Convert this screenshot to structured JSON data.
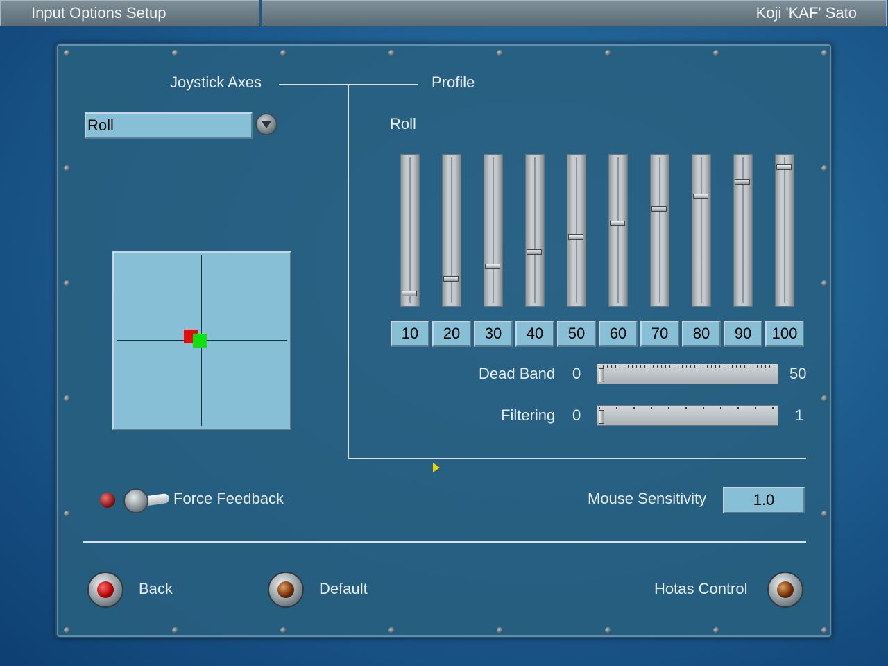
{
  "header": {
    "title": "Input Options Setup",
    "user": "Koji 'KAF' Sato"
  },
  "axes": {
    "heading": "Joystick Axes",
    "selected": "Roll"
  },
  "profile": {
    "heading": "Profile",
    "axis_label": "Roll",
    "points": [
      {
        "label": "10",
        "level": 0.05
      },
      {
        "label": "20",
        "level": 0.15
      },
      {
        "label": "30",
        "level": 0.24
      },
      {
        "label": "40",
        "level": 0.34
      },
      {
        "label": "50",
        "level": 0.44
      },
      {
        "label": "60",
        "level": 0.54
      },
      {
        "label": "70",
        "level": 0.64
      },
      {
        "label": "80",
        "level": 0.73
      },
      {
        "label": "90",
        "level": 0.83
      },
      {
        "label": "100",
        "level": 0.93
      }
    ],
    "dead_band": {
      "label": "Dead Band",
      "min": "0",
      "max": "50",
      "value": 0
    },
    "filtering": {
      "label": "Filtering",
      "min": "0",
      "max": "1",
      "value": 0
    }
  },
  "force_feedback": {
    "label": "Force Feedback"
  },
  "mouse": {
    "label": "Mouse Sensitivity",
    "value": "1.0"
  },
  "buttons": {
    "back": "Back",
    "default": "Default",
    "hotas": "Hotas Control"
  },
  "colors": {
    "field": "#86bfd6",
    "panel": "#285f80",
    "text": "#e6eef3"
  }
}
